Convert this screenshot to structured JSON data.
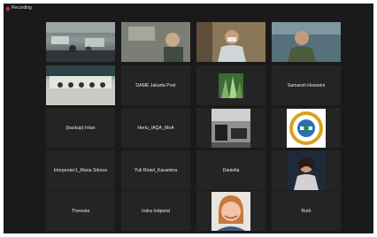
{
  "recording": {
    "label": "Recording",
    "color": "#e02a2a"
  },
  "accent": {
    "active_speaker_outline": "#f2e600"
  },
  "participants": [
    {
      "name": "",
      "video": true,
      "icon": "video-feed"
    },
    {
      "name": "",
      "video": true,
      "icon": "video-feed"
    },
    {
      "name": "",
      "video": true,
      "icon": "video-feed"
    },
    {
      "name": "",
      "video": true,
      "icon": "video-feed"
    },
    {
      "name": "",
      "video": true,
      "icon": "video-feed",
      "active_speaker": true
    },
    {
      "name": "DAME Jakarta Post",
      "video": false
    },
    {
      "name": "",
      "video": false,
      "icon": "profile-photo"
    },
    {
      "name": "Samareh Hosseini",
      "video": false
    },
    {
      "name": "(backup) Intan",
      "video": false
    },
    {
      "name": "Heriu_IAQA_MoA",
      "video": false
    },
    {
      "name": "",
      "video": false,
      "icon": "profile-photo"
    },
    {
      "name": "",
      "video": false,
      "icon": "logo-emblem"
    },
    {
      "name": "Interpreter1_Maria Sitorus",
      "video": false
    },
    {
      "name": "Yuli Rintel_Karamina",
      "video": false
    },
    {
      "name": "Daniella",
      "video": false
    },
    {
      "name": "",
      "video": false,
      "icon": "profile-photo"
    },
    {
      "name": "Theresia",
      "video": false
    },
    {
      "name": "Indra Indpetal",
      "video": false
    },
    {
      "name": "",
      "video": false,
      "icon": "profile-photo"
    },
    {
      "name": "Ruth",
      "video": false
    }
  ]
}
